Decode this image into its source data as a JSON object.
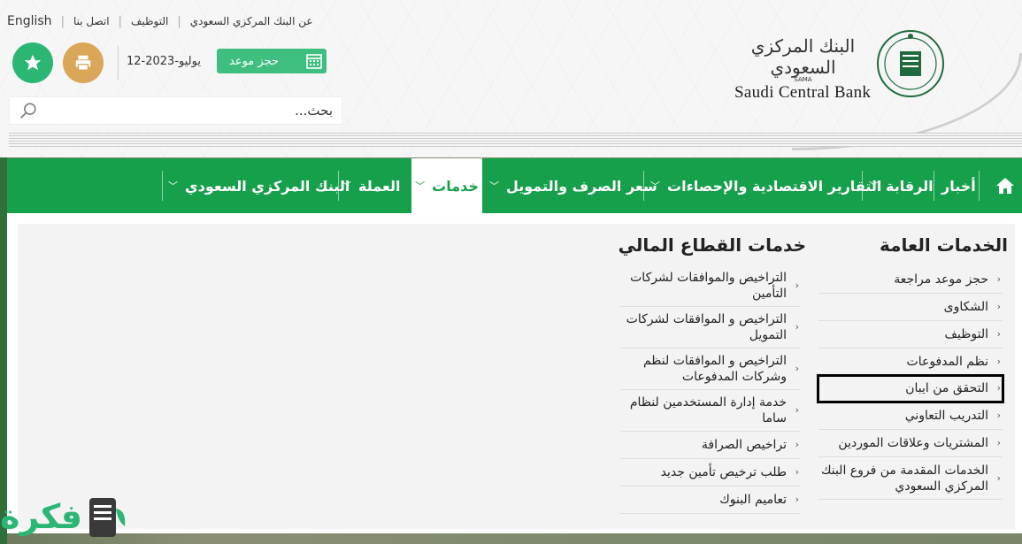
{
  "toplinks": {
    "english": "English",
    "contact": "اتصل بنا",
    "jobs": "التوظيف",
    "about": "عن البنك المركزي السعودي"
  },
  "header": {
    "date": "12-يوليو-2023",
    "appointment_label": "حجز موعد",
    "search_placeholder": "بحث...",
    "logo_ar": "البنك المركزي السعودي",
    "logo_sama": "SAMA",
    "logo_en": "Saudi Central Bank"
  },
  "nav": {
    "news": "أخبار",
    "supervision": "الرقابة",
    "reports": "التقارير الاقتصادية والإحصاءات",
    "exchange": "سعر الصرف والتمويل",
    "services": "خدمات",
    "currency": "العملة",
    "central_bank": "البنك المركزي السعودي"
  },
  "general_services": {
    "title": "الخدمات العامة",
    "items": [
      "حجز موعد مراجعة",
      "الشكاوى",
      "التوظيف",
      "نظم المدفوعات",
      "التحقق من ايبان",
      "التدريب التعاوني",
      "المشتريات وعلاقات الموردين",
      "الخدمات المقدمة من فروع البنك المركزي السعودي"
    ]
  },
  "financial_services": {
    "title": "خدمات القطاع المالي",
    "items": [
      "التراخيص والموافقات لشركات التأمين",
      "التراخيص و الموافقات لشركات التمويل",
      "التراخيص و الموافقات لنظم وشركات المدفوعات",
      "خدمة إدارة المستخدمين لنظام ساما",
      "تراخيص الصرافة",
      "طلب ترخيص تأمين جديد",
      "تعاميم البنوك"
    ]
  },
  "watermark": "فكرة",
  "colors": {
    "nav_green": "#16a04b",
    "star_btn": "#2bb673",
    "print_btn": "#d9a757",
    "appt_btn": "#3fbf7f"
  }
}
